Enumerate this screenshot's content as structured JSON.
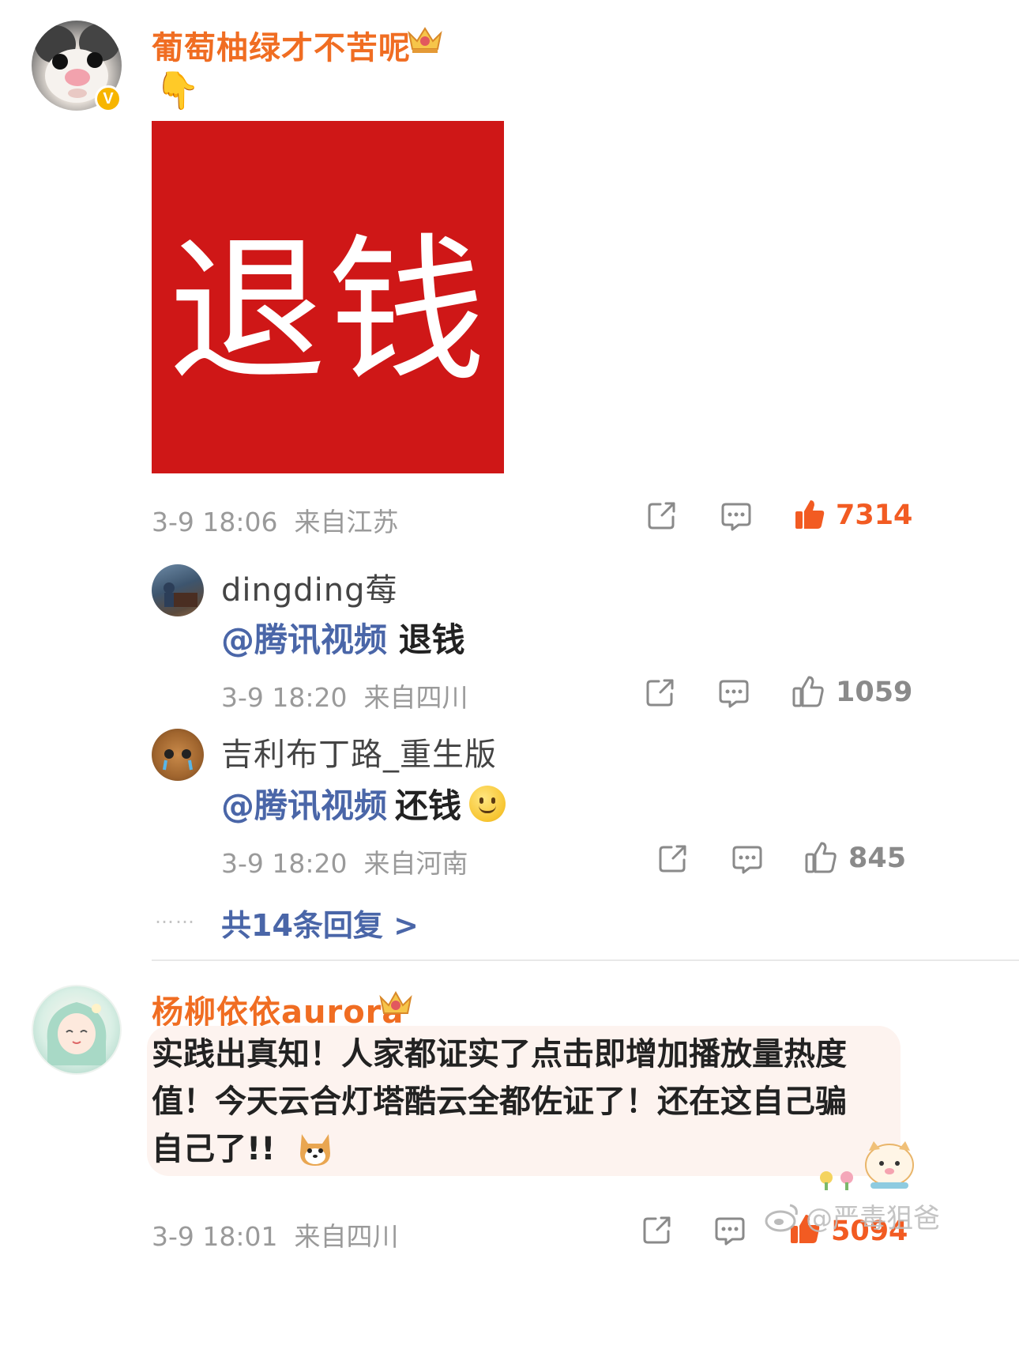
{
  "comment1": {
    "username": "葡萄柚绿才不苦呢",
    "emoji": "👇",
    "image_text": "退钱",
    "timestamp": "3-9 18:06",
    "location": "来自江苏",
    "likes": "7314"
  },
  "reply1": {
    "username": "dingding莓",
    "mention": "@腾讯视频",
    "text": "退钱",
    "timestamp": "3-9 18:20",
    "location": "来自四川",
    "likes": "1059"
  },
  "reply2": {
    "username": "吉利布丁路_重生版",
    "mention": "@腾讯视频",
    "text": "还钱",
    "timestamp": "3-9 18:20",
    "location": "来自河南",
    "likes": "845"
  },
  "more_replies": {
    "dots": "……",
    "label": "共14条回复 >"
  },
  "comment2": {
    "username": "杨柳依依aurora",
    "text_line1": "实践出真知！人家都证实了点击即增加播放量热度",
    "text_line2": "值！今天云合灯塔酷云全都佐证了！还在这自己骗",
    "text_line3": "自己了!!",
    "timestamp": "3-9 18:01",
    "location": "来自四川",
    "likes": "5094"
  },
  "watermark": "@严毒狙爸",
  "colors": {
    "accent_orange": "#f06d22",
    "mention_blue": "#4a66a8",
    "red_card": "#cf1717",
    "meta_gray": "#9a9a9a"
  },
  "icons": [
    "verified-badge-icon",
    "crown-icon",
    "share-icon",
    "comment-icon",
    "like-icon",
    "weibo-logo-icon"
  ]
}
